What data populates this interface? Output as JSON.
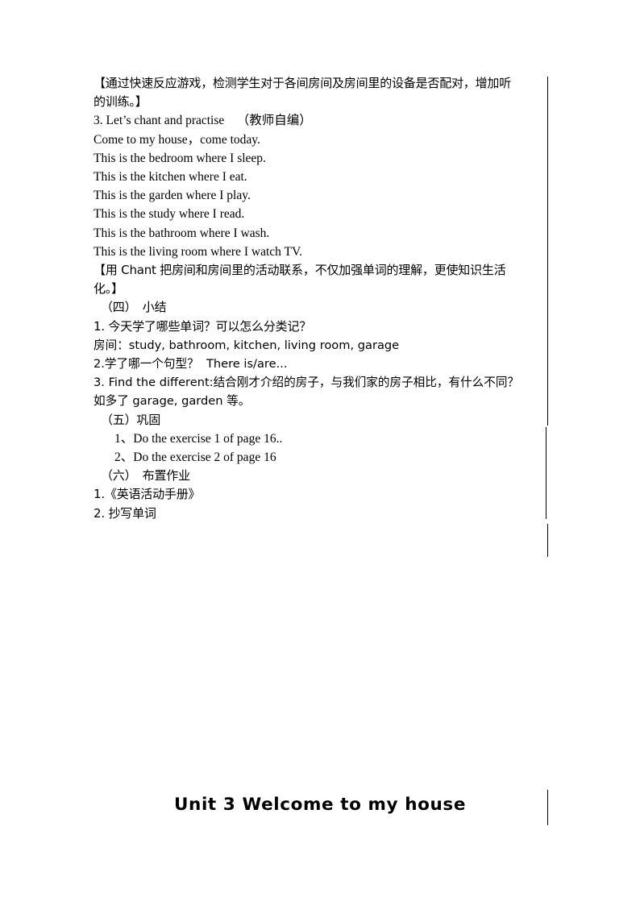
{
  "document": {
    "body_lines": [
      {
        "id": "note-listening-1",
        "text": "【通过快速反应游戏，检测学生对于各间房间及房间里的设备是否配对，增加听",
        "style": "cn",
        "indent": 0
      },
      {
        "id": "note-listening-2",
        "text": "的训练。】",
        "style": "cn",
        "indent": 0
      },
      {
        "id": "activity-3-title",
        "text": "3. Let’s chant and practise    （教师自编）",
        "style": "mixed",
        "indent": 0
      },
      {
        "id": "chant-line-1",
        "text": "Come to my house，come today.",
        "style": "en",
        "indent": 0
      },
      {
        "id": "chant-line-2",
        "text": "This is the bedroom where I sleep.",
        "style": "en",
        "indent": 0
      },
      {
        "id": "chant-line-3",
        "text": "This is the kitchen where I eat.",
        "style": "en",
        "indent": 0
      },
      {
        "id": "chant-line-4",
        "text": "This is the garden where I play.",
        "style": "en",
        "indent": 0
      },
      {
        "id": "chant-line-5",
        "text": "This is the study where I read.",
        "style": "en",
        "indent": 0
      },
      {
        "id": "chant-line-6",
        "text": "This is the bathroom where I wash.",
        "style": "en",
        "indent": 0
      },
      {
        "id": "chant-line-7",
        "text": "This is the living room where I watch TV.",
        "style": "en",
        "indent": 0
      },
      {
        "id": "note-chant-1",
        "text": "【用 Chant 把房间和房间里的活动联系，不仅加强单词的理解，更使知识生活",
        "style": "cn",
        "indent": 0
      },
      {
        "id": "note-chant-2",
        "text": "化。】",
        "style": "cn",
        "indent": 0
      },
      {
        "id": "section-four-heading",
        "text": "（四）　小结",
        "style": "cn",
        "indent": 1
      },
      {
        "id": "summary-q1",
        "text": "1. 今天学了哪些单词？可以怎么分类记？",
        "style": "cn",
        "indent": 0
      },
      {
        "id": "summary-rooms",
        "text": "房间：study, bathroom, kitchen, living room, garage",
        "style": "mixed",
        "indent": 0
      },
      {
        "id": "summary-q2",
        "text": "2.学了哪一个句型？  There is/are...",
        "style": "mixed",
        "indent": 0
      },
      {
        "id": "summary-q3-line1",
        "text": "3. Find the different:结合刚才介绍的房子，与我们家的房子相比，有什么不同？",
        "style": "mixed",
        "indent": 0
      },
      {
        "id": "summary-q3-line2",
        "text": "如多了 garage, garden 等。",
        "style": "mixed",
        "indent": 0
      },
      {
        "id": "section-five-heading",
        "text": "（五）巩固",
        "style": "cn",
        "indent": 1
      },
      {
        "id": "exercise-item-1",
        "text": "1、Do the exercise 1 of page 16..",
        "style": "mixed",
        "indent": 2
      },
      {
        "id": "exercise-item-2",
        "text": "2、Do the exercise 2 of page 16",
        "style": "mixed",
        "indent": 2
      },
      {
        "id": "section-six-heading",
        "text": "（六）　布置作业",
        "style": "cn",
        "indent": 1
      },
      {
        "id": "homework-item-1",
        "text": "1.《英语活动手册》",
        "style": "cn",
        "indent": 0
      },
      {
        "id": "homework-item-2",
        "text": "2. 抄写单词",
        "style": "cn",
        "indent": 0
      }
    ],
    "unit_heading": "Unit 3   Welcome to my house",
    "rule_color": "#000000"
  }
}
